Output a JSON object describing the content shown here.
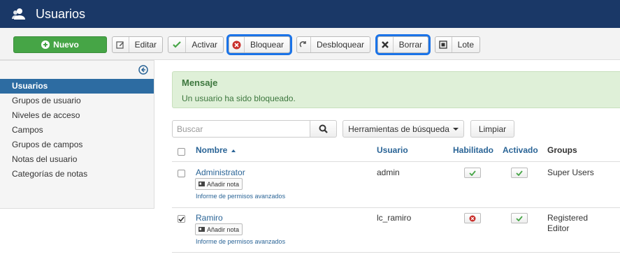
{
  "header": {
    "title": "Usuarios",
    "icon": "users-icon"
  },
  "toolbar": {
    "nuevo": "Nuevo",
    "editar": "Editar",
    "activar": "Activar",
    "bloquear": "Bloquear",
    "desbloquear": "Desbloquear",
    "borrar": "Borrar",
    "lote": "Lote"
  },
  "sidebar": {
    "items": [
      {
        "label": "Usuarios"
      },
      {
        "label": "Grupos de usuario"
      },
      {
        "label": "Niveles de acceso"
      },
      {
        "label": "Campos"
      },
      {
        "label": "Grupos de campos"
      },
      {
        "label": "Notas del usuario"
      },
      {
        "label": "Categorías de notas"
      }
    ]
  },
  "alert": {
    "heading": "Mensaje",
    "message": "Un usuario ha sido bloqueado."
  },
  "search": {
    "placeholder": "Buscar",
    "tools": "Herramientas de búsqueda",
    "clear": "Limpiar"
  },
  "table": {
    "columns": {
      "name": "Nombre",
      "user": "Usuario",
      "enabled": "Habilitado",
      "activated": "Activado",
      "groups": "Groups"
    },
    "rows": [
      {
        "name": "Administrator",
        "note": "Añadir nota",
        "perm": "Informe de permisos avanzados",
        "username": "admin",
        "enabled": true,
        "activated": true,
        "groups_line1": "Super Users",
        "groups_line2": "",
        "checked": false
      },
      {
        "name": "Ramiro",
        "note": "Añadir nota",
        "perm": "Informe de permisos avanzados",
        "username": "lc_ramiro",
        "enabled": false,
        "activated": true,
        "groups_line1": "Registered",
        "groups_line2": "Editor",
        "checked": true
      }
    ]
  },
  "colors": {
    "header": "#1a3867",
    "active_sidebar": "#2d6ca2",
    "success": "#46a546",
    "highlight": "#1a73e8",
    "danger": "#c9302c"
  }
}
